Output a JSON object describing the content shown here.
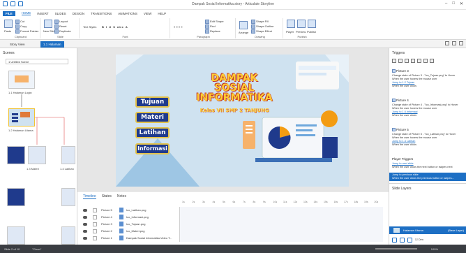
{
  "window": {
    "title": "Dampak Sosial Informatika.story - Articulate Storyline"
  },
  "menu": [
    "FILE",
    "HOME",
    "INSERT",
    "SLIDES",
    "DESIGN",
    "TRANSITIONS",
    "ANIMATIONS",
    "VIEW",
    "HELP"
  ],
  "ribbon": {
    "clipboard": {
      "label": "Clipboard",
      "paste": "Paste",
      "cut": "Cut",
      "copy": "Copy",
      "format": "Format Painter"
    },
    "slide": {
      "label": "Slide",
      "new": "New Slide",
      "layout": "Layout",
      "reset": "Reset",
      "duplicate": "Duplicate"
    },
    "font": {
      "label": "Font",
      "name": "Text Styles"
    },
    "paragraph": {
      "label": "Paragraph",
      "edit_shape": "Edit Shape",
      "shape_fill": "Shape Fill",
      "shape_outline": "Shape Outline",
      "shape_effect": "Shape Effect",
      "find": "Find",
      "replace": "Replace"
    },
    "drawing": {
      "label": "Drawing",
      "arrange": "Arrange",
      "quick_styles": "Quick Styles"
    },
    "publish": {
      "label": "Publish",
      "player": "Player",
      "preview": "Preview",
      "publish": "Publish"
    }
  },
  "tabs": {
    "story_view": "Story View",
    "slide_tab": "1.1 Halaman"
  },
  "scenes": {
    "header": "Scenes",
    "selected": "1 Untitled Scene",
    "items": [
      "1.1 Halaman Login",
      "1.2 Halaman Utama",
      "1.3 Materi",
      "1.4 Latihan"
    ]
  },
  "slide": {
    "title_lines": [
      "DAMPAK",
      "SOSIAL",
      "INFORMATIKA"
    ],
    "subtitle": "Kelas VII SMP 2 TANJUNG",
    "buttons": [
      "Tujuan",
      "Materi",
      "Latihan",
      "Informasi"
    ],
    "colors": {
      "button_bg": "#1f3a8c",
      "button_border": "#e3c24b",
      "title": "#ffcc33",
      "title_outline": "#c0392b",
      "slide_bg": "#cfe2f0"
    }
  },
  "timeline": {
    "tabs": [
      "Timeline",
      "States",
      "Notes"
    ],
    "rows": [
      {
        "name": "Picture 5",
        "file": "Ico_Latihan.png"
      },
      {
        "name": "Picture 4",
        "file": "Ico_Informasi.png"
      },
      {
        "name": "Picture 3",
        "file": "Ico_Tujuan.png"
      },
      {
        "name": "Picture 2",
        "file": "Ico_Materi.png"
      },
      {
        "name": "Picture 1",
        "file": "Dampak Sosial Informatika Video T..."
      }
    ],
    "ruler": [
      "1s",
      "2s",
      "3s",
      "4s",
      "5s",
      "6s",
      "7s",
      "8s",
      "9s",
      "10s",
      "11s",
      "12s",
      "13s",
      "14s",
      "15s",
      "16s",
      "17s",
      "18s",
      "19s",
      "20s"
    ]
  },
  "triggers": {
    "header": "Triggers",
    "groups": [
      {
        "title": "Picture 3",
        "lines": [
          "Change state of Picture 3 - \"Ico_Tujuan.png\" to Hover",
          "When the user hovers the mouse over",
          "Jump to 1.2 Tujuan",
          "When the user clicks"
        ]
      },
      {
        "title": "Picture 4",
        "lines": [
          "Change state of Picture 4 - \"Ico_Informasi.png\" to Hover",
          "When the user hovers the mouse over",
          "Jump to 1.6 Informasi",
          "When the user clicks"
        ]
      },
      {
        "title": "Picture 5",
        "lines": [
          "Change state of Picture 5 - \"Ico_Latihan.png\" to Hover",
          "When the user hovers the mouse over",
          "Jump to 1.4 Latihan",
          "When the user clicks"
        ]
      }
    ],
    "player_header": "Player Triggers",
    "player_lines": [
      "Jump to next slide",
      "When the user clicks the next button or swipes next",
      "Jump to previous slide",
      "When the user clicks the previous button or swipes..."
    ]
  },
  "layers": {
    "header": "Slide Layers",
    "base": "Halaman Utama",
    "base_tag": "(Base Layer)",
    "dim": "Dim"
  },
  "status": {
    "left": "Slide 2 of 10",
    "theme": "\"Clean\"",
    "zoom": "100%"
  }
}
